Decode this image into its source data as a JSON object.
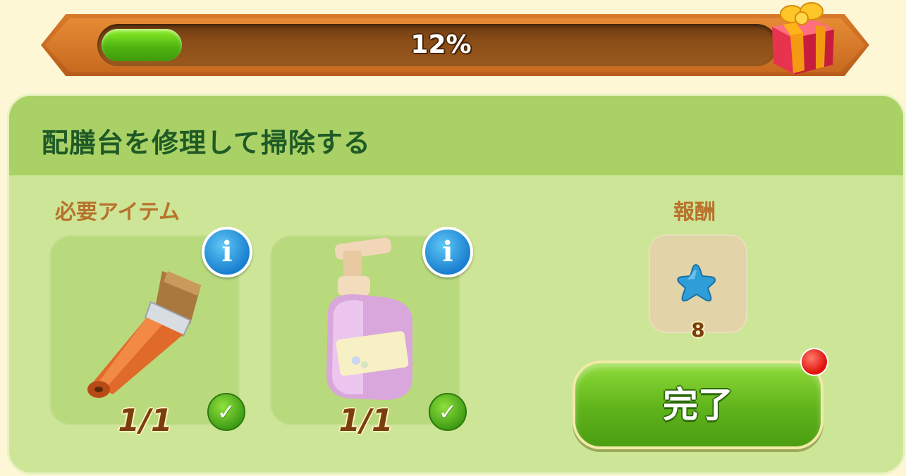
{
  "progress": {
    "label": "12%",
    "value": 0.12
  },
  "task": {
    "title": "配膳台を修理して掃除する"
  },
  "required": {
    "label": "必要アイテム",
    "items": [
      {
        "icon": "paintbrush-icon",
        "count": "1/1",
        "info": "i"
      },
      {
        "icon": "soap-bottle-icon",
        "count": "1/1",
        "info": "i"
      }
    ]
  },
  "reward": {
    "label": "報酬",
    "icon": "blue-star-icon",
    "count": "8"
  },
  "actions": {
    "complete_label": "完了"
  },
  "check_glyph": "✓",
  "colors": {
    "progress_fill": "#5fc016",
    "title": "#1f5a26",
    "section_label": "#b8722c",
    "button": "#5fb31a"
  }
}
